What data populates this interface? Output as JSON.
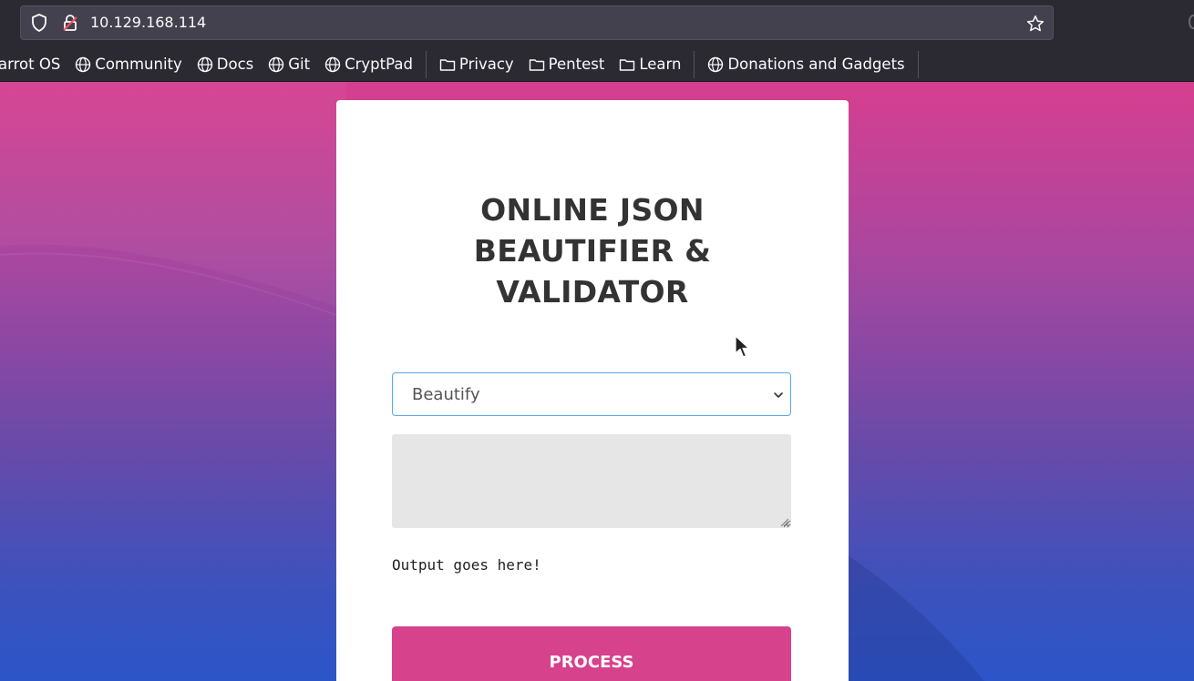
{
  "browser": {
    "url": "10.129.168.114",
    "bookmarks": [
      {
        "label": "arrot OS",
        "icon": "none"
      },
      {
        "label": "Community",
        "icon": "globe-icon"
      },
      {
        "label": "Docs",
        "icon": "globe-icon"
      },
      {
        "label": "Git",
        "icon": "globe-icon"
      },
      {
        "label": "CryptPad",
        "icon": "globe-icon"
      },
      {
        "label": "Privacy",
        "icon": "folder-icon"
      },
      {
        "label": "Pentest",
        "icon": "folder-icon"
      },
      {
        "label": "Learn",
        "icon": "folder-icon"
      },
      {
        "label": "Donations and Gadgets",
        "icon": "globe-icon"
      }
    ]
  },
  "card": {
    "title_lines": [
      "ONLINE JSON",
      "BEAUTIFIER &",
      "VALIDATOR"
    ],
    "mode_select": {
      "selected": "Beautify"
    },
    "input_value": "",
    "output_text": "Output goes here!",
    "process_label": "PROCESS"
  },
  "colors": {
    "accent": "#d6428c",
    "select_border": "#57a6ea",
    "input_bg": "#e6e6e6",
    "title": "#333333"
  }
}
